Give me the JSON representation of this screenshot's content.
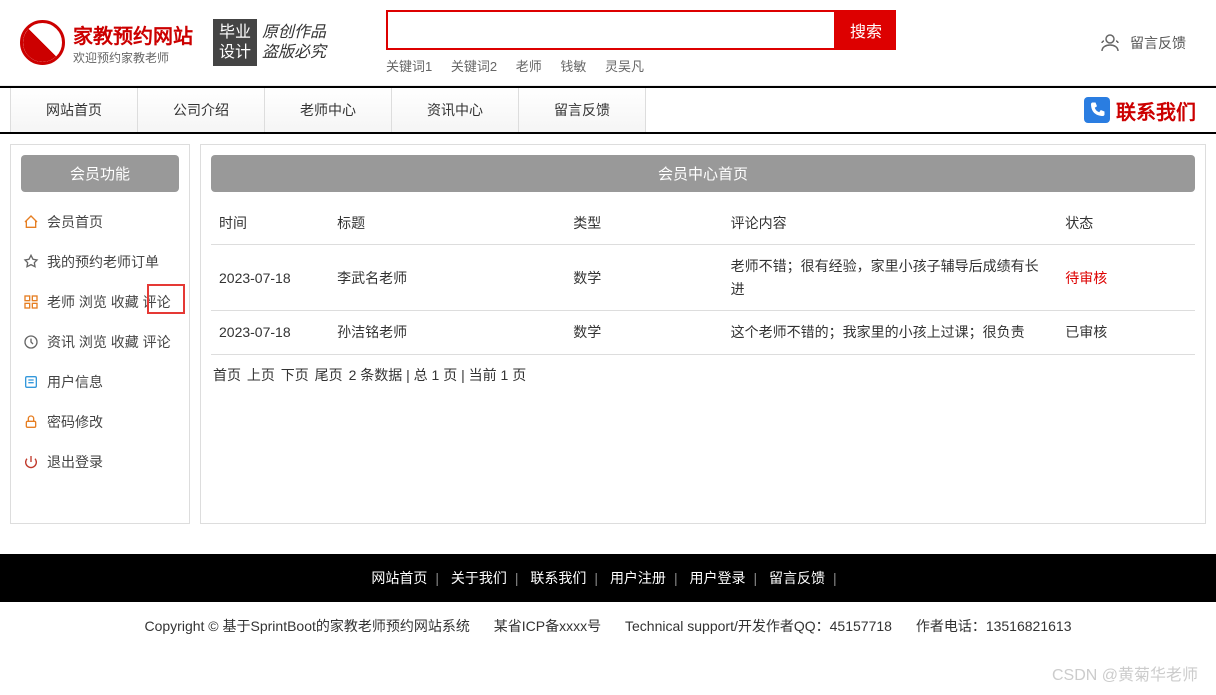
{
  "header": {
    "logo_title": "家教预约网站",
    "logo_sub": "欢迎预约家教老师",
    "badge_grad": "毕业\n设计",
    "badge_orig_line1": "原创作品",
    "badge_orig_line2": "盗版必究",
    "search_button": "搜索",
    "keywords": [
      "关键词1",
      "关键词2",
      "老师",
      "钱敏",
      "灵吴凡"
    ],
    "feedback_label": "留言反馈"
  },
  "nav": {
    "items": [
      "网站首页",
      "公司介绍",
      "老师中心",
      "资讯中心",
      "留言反馈"
    ],
    "contact": "联系我们"
  },
  "sidebar": {
    "header": "会员功能",
    "items": [
      {
        "label": "会员首页",
        "icon": "home"
      },
      {
        "label": "我的预约老师订单",
        "icon": "order"
      },
      {
        "label": "老师 浏览 收藏 评论",
        "icon": "grid",
        "highlight": true
      },
      {
        "label": "资讯 浏览 收藏 评论",
        "icon": "clock"
      },
      {
        "label": "用户信息",
        "icon": "user"
      },
      {
        "label": "密码修改",
        "icon": "lock"
      },
      {
        "label": "退出登录",
        "icon": "power"
      }
    ]
  },
  "content": {
    "header": "会员中心首页",
    "columns": [
      "时间",
      "标题",
      "类型",
      "评论内容",
      "状态"
    ],
    "rows": [
      {
        "time": "2023-07-18",
        "title": "李武名老师",
        "type": "数学",
        "comment": "老师不错；很有经验，家里小孩子辅导后成绩有长进",
        "status": "待审核",
        "pending": true
      },
      {
        "time": "2023-07-18",
        "title": "孙洁铭老师",
        "type": "数学",
        "comment": "这个老师不错的；我家里的小孩上过课；很负责",
        "status": "已审核",
        "pending": false
      }
    ],
    "pagination": {
      "first": "首页",
      "prev": "上页",
      "next": "下页",
      "last": "尾页",
      "summary": "2 条数据 | 总 1 页 | 当前 1 页"
    }
  },
  "footer": {
    "links": [
      "网站首页",
      "关于我们",
      "联系我们",
      "用户注册",
      "用户登录",
      "留言反馈"
    ],
    "copyright": "Copyright © 基于SprintBoot的家教老师预约网站系统",
    "icp": "某省ICP备xxxx号",
    "support": "Technical support/开发作者QQ：45157718",
    "author_phone": "作者电话：13516821613"
  },
  "watermark": "CSDN @黄菊华老师"
}
